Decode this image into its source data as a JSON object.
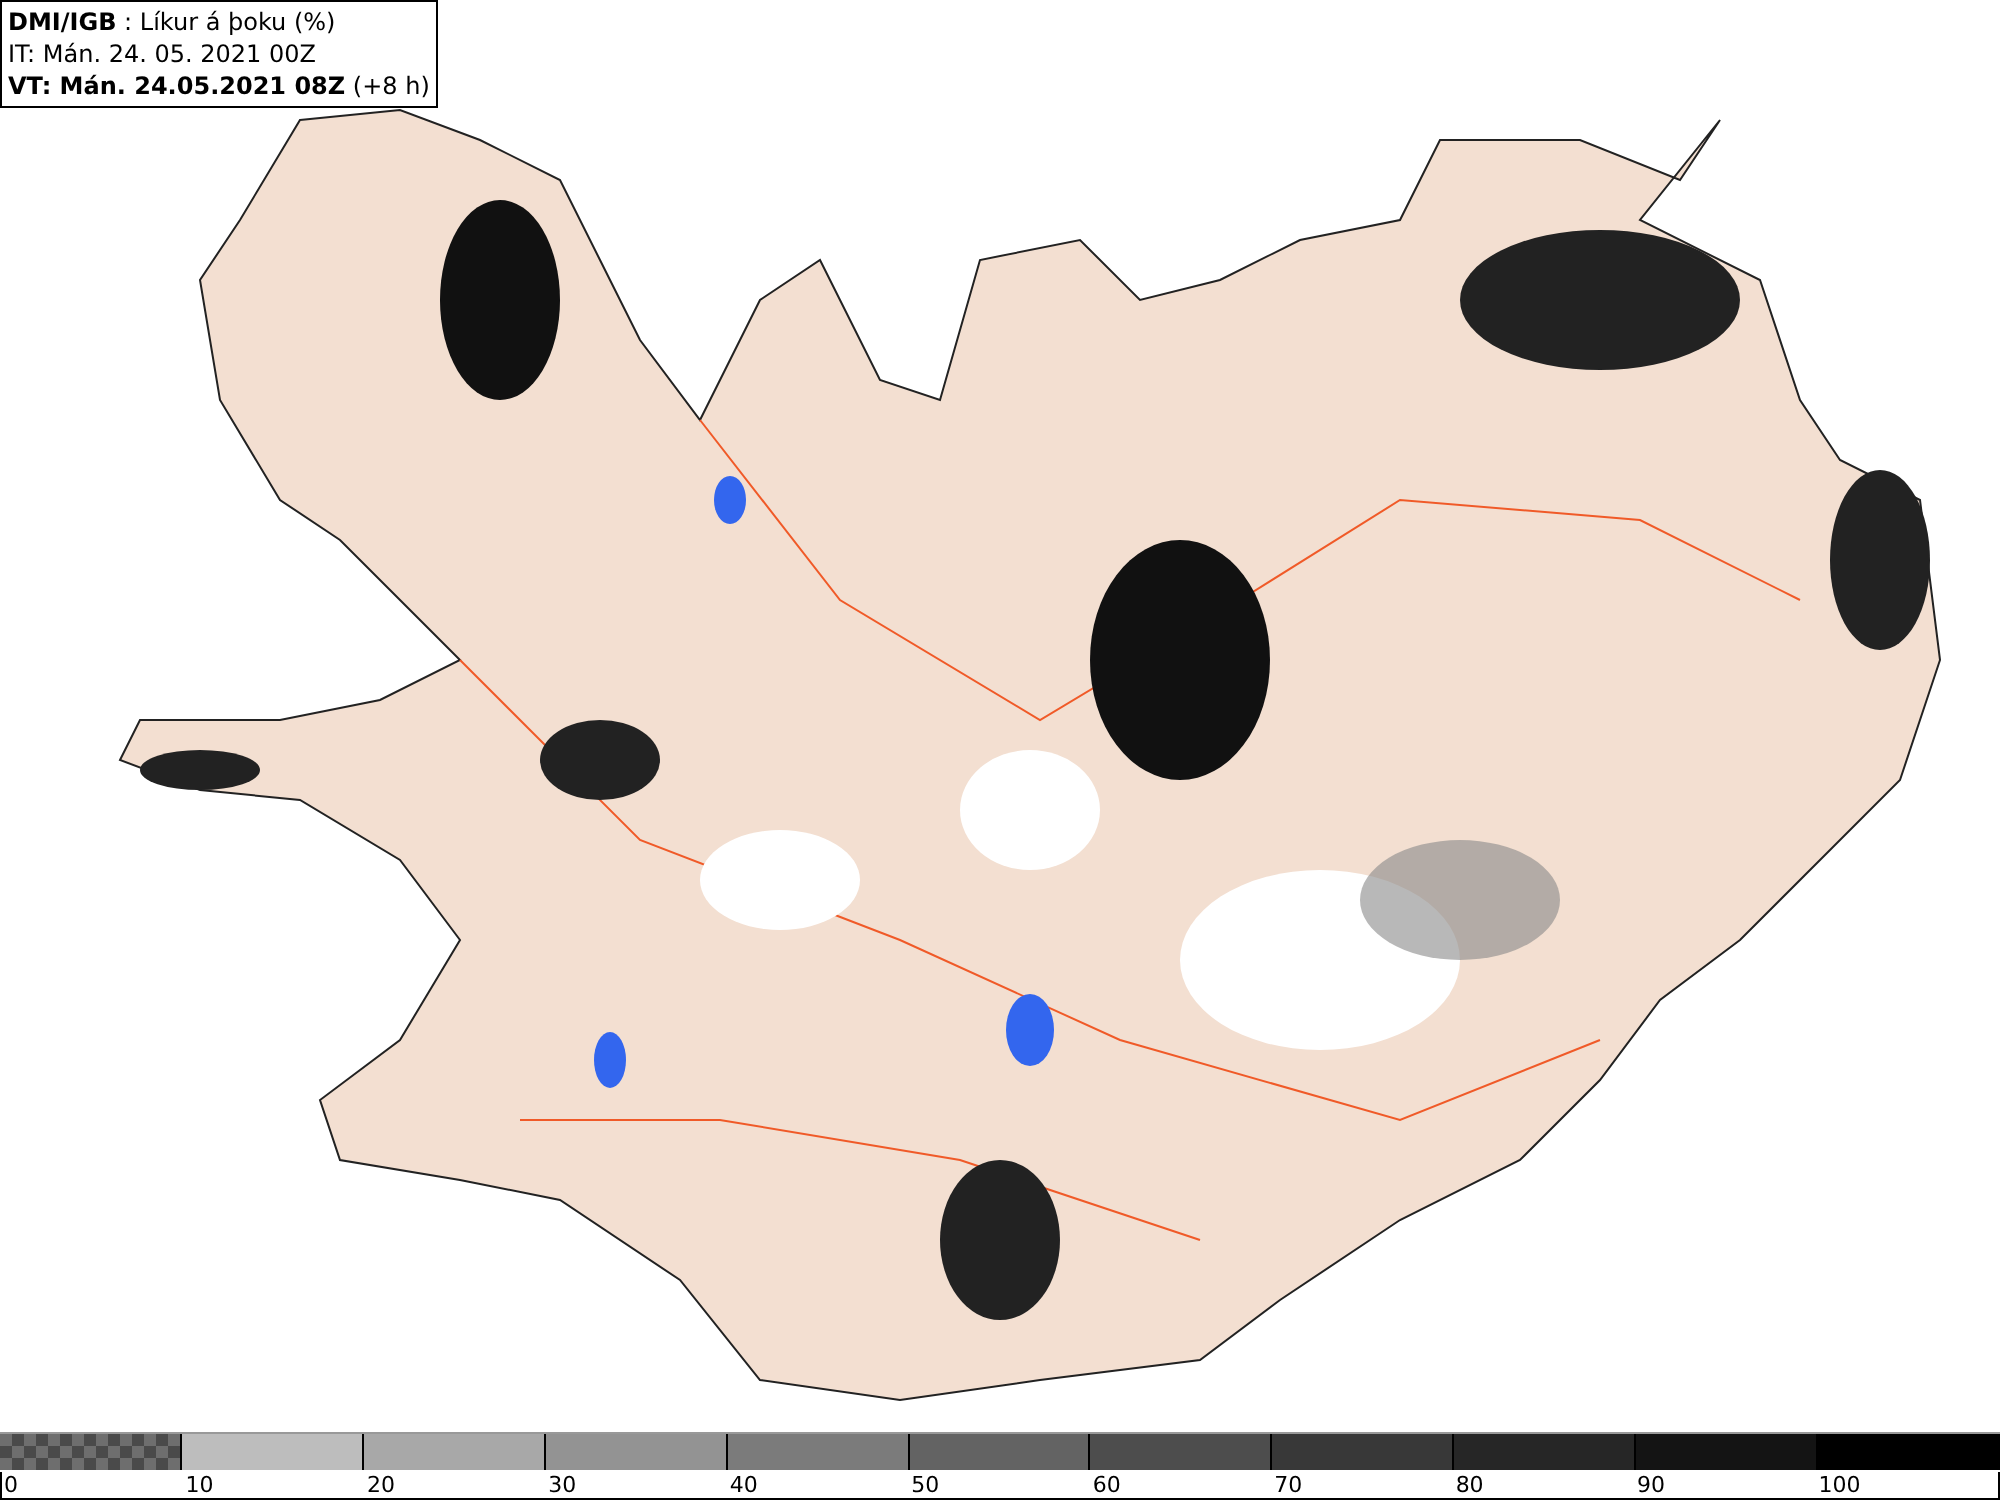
{
  "header": {
    "lines": [
      "**DMI/IGB** : Líkur á þoku (%)",
      "IT: Mán. 24. 05. 2021 00Z",
      "**VT: Mán. 24.05.2021 08Z** (+8 h)"
    ]
  },
  "legend": {
    "segments": [
      {
        "kind": "checker",
        "color": "#6e6e6e"
      },
      {
        "kind": "solid",
        "color": "#bdbdbd"
      },
      {
        "kind": "solid",
        "color": "#a8a8a8"
      },
      {
        "kind": "solid",
        "color": "#939393"
      },
      {
        "kind": "solid",
        "color": "#7b7b7b"
      },
      {
        "kind": "solid",
        "color": "#636363"
      },
      {
        "kind": "solid",
        "color": "#4d4d4d"
      },
      {
        "kind": "solid",
        "color": "#383838"
      },
      {
        "kind": "solid",
        "color": "#262626"
      },
      {
        "kind": "solid",
        "color": "#141414"
      },
      {
        "kind": "solid",
        "color": "#000000"
      }
    ],
    "labels": [
      "0",
      "10",
      "20",
      "30",
      "40",
      "50",
      "60",
      "70",
      "80",
      "90",
      "100"
    ]
  }
}
